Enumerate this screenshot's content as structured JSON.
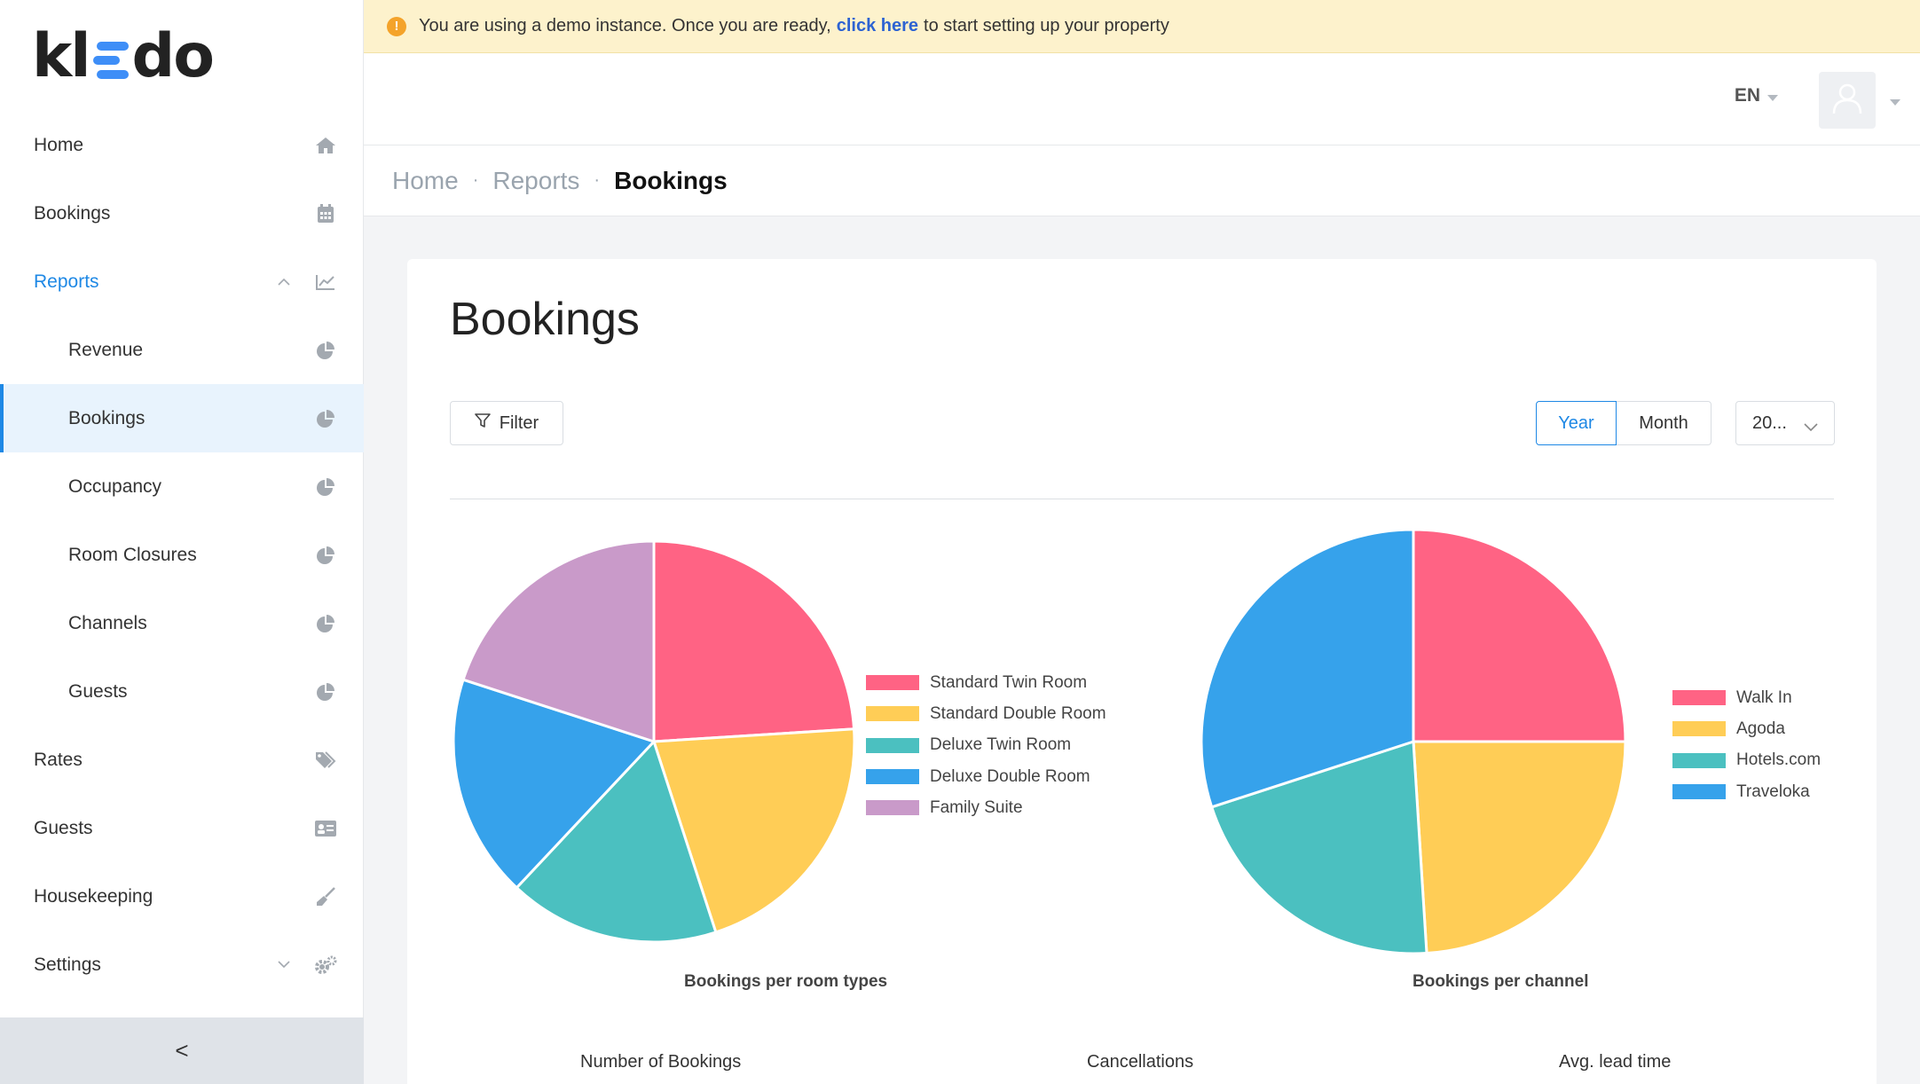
{
  "brand": {
    "logo_text_left": "kl",
    "logo_text_right": "do"
  },
  "colors": {
    "accent": "#1e88e5",
    "banner_bg": "#fdf2cc",
    "warning": "#f4a32a"
  },
  "banner": {
    "text_before": "You are using a demo instance. Once you are ready,",
    "link": "click here",
    "text_after": "to start setting up your property"
  },
  "sidebar": {
    "items": [
      {
        "label": "Home",
        "icon": "home-icon"
      },
      {
        "label": "Bookings",
        "icon": "calendar-icon"
      },
      {
        "label": "Reports",
        "icon": "line-chart-icon",
        "expanded": true
      },
      {
        "label": "Revenue",
        "icon": "pie-chart-icon"
      },
      {
        "label": "Bookings",
        "icon": "pie-chart-icon",
        "active": true
      },
      {
        "label": "Occupancy",
        "icon": "pie-chart-icon"
      },
      {
        "label": "Room Closures",
        "icon": "pie-chart-icon"
      },
      {
        "label": "Channels",
        "icon": "pie-chart-icon"
      },
      {
        "label": "Guests",
        "icon": "pie-chart-icon"
      },
      {
        "label": "Rates",
        "icon": "tags-icon"
      },
      {
        "label": "Guests",
        "icon": "id-card-icon"
      },
      {
        "label": "Housekeeping",
        "icon": "broom-icon"
      },
      {
        "label": "Settings",
        "icon": "gears-icon"
      }
    ],
    "collapse_label": "<"
  },
  "header": {
    "language": "EN",
    "avatar_icon": "user-icon"
  },
  "breadcrumb": {
    "home": "Home",
    "reports": "Reports",
    "current": "Bookings"
  },
  "page": {
    "title": "Bookings",
    "filter_label": "Filter",
    "period_year": "Year",
    "period_month": "Month",
    "year_select": "20..."
  },
  "stats": {
    "bookings_label": "Number of Bookings",
    "cancellations_label": "Cancellations",
    "lead_time_label": "Avg. lead time"
  },
  "chart_data": [
    {
      "type": "pie",
      "title": "Bookings per room types",
      "categories": [
        "Standard Twin Room",
        "Standard Double Room",
        "Deluxe Twin Room",
        "Deluxe Double Room",
        "Family Suite"
      ],
      "values": [
        24,
        21,
        17,
        18,
        20
      ],
      "colors": [
        "#ff6384",
        "#ffcd56",
        "#4bc0c0",
        "#36a2eb",
        "#c99ac9"
      ],
      "legend": "right"
    },
    {
      "type": "pie",
      "title": "Bookings per channel",
      "categories": [
        "Walk In",
        "Agoda",
        "Hotels.com",
        "Traveloka"
      ],
      "values": [
        25,
        24,
        21,
        30
      ],
      "colors": [
        "#ff6384",
        "#ffcd56",
        "#4bc0c0",
        "#36a2eb"
      ],
      "legend": "right"
    }
  ]
}
